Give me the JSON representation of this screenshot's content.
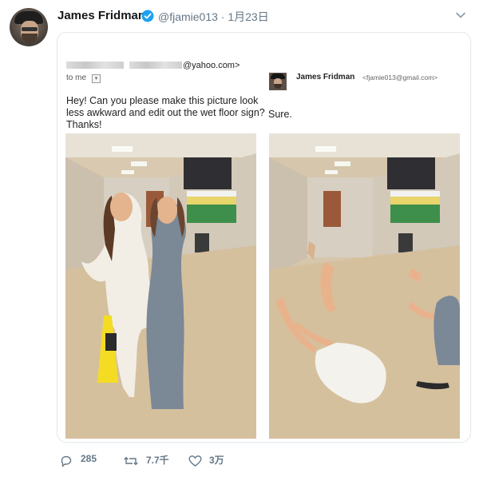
{
  "tweet": {
    "author_name": "James Fridman",
    "author_handle": "@fjamie013",
    "date": "1月23日",
    "handle_date": "@fjamie013 · 1月23日"
  },
  "email": {
    "from_domain": "@yahoo.com>",
    "to_label": "to me",
    "dropdown_glyph": "▾",
    "request_text": "Hey! Can you please make this picture look less awkward and edit out the wet floor sign? Thanks!",
    "reply_name": "James Fridman",
    "reply_email": "<fjamie013@gmail.com>",
    "reply_text": "Sure."
  },
  "stats": {
    "replies": "285",
    "retweets": "7.7千",
    "likes": "3万"
  },
  "icons": [
    "verified-badge-icon",
    "chevron-down-icon",
    "reply-icon",
    "retweet-icon",
    "like-icon"
  ],
  "colors": {
    "verified": "#1da1f2",
    "secondary_text": "#657786",
    "border": "#e1e8ed"
  }
}
